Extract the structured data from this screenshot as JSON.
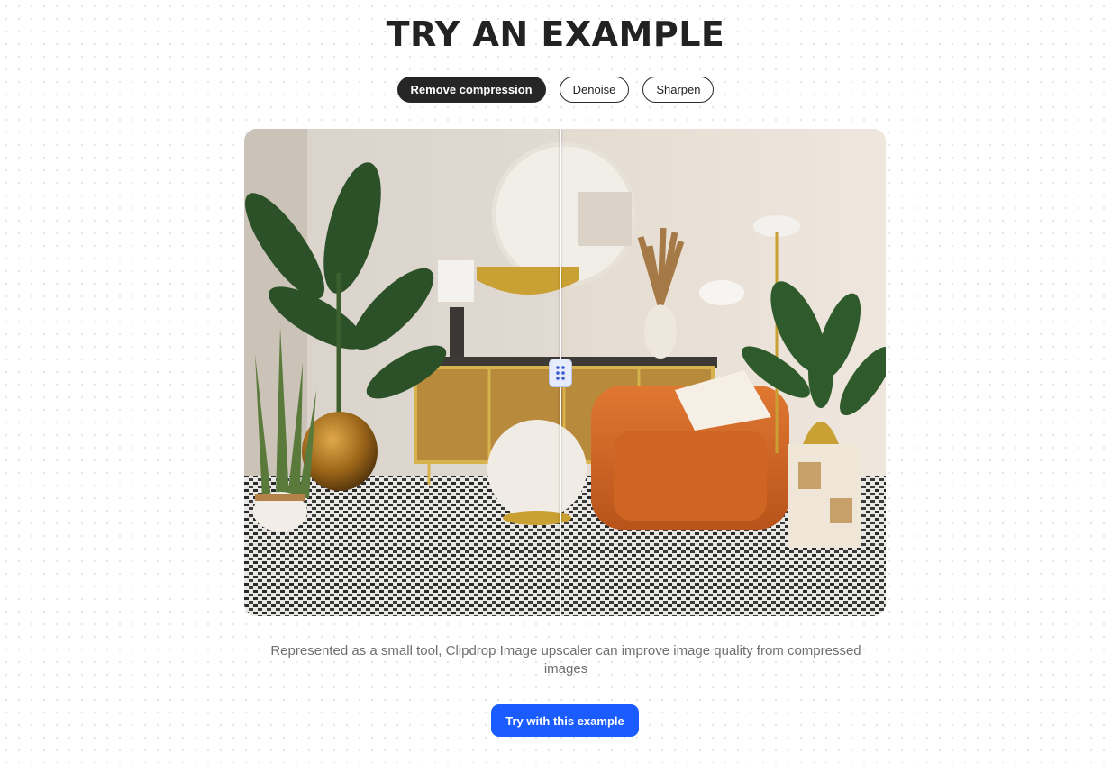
{
  "heading": "TRY AN EXAMPLE",
  "tabs": [
    {
      "label": "Remove compression",
      "active": true
    },
    {
      "label": "Denoise",
      "active": false
    },
    {
      "label": "Sharpen",
      "active": false
    }
  ],
  "comparison": {
    "image_description_icon": "interior-living-room-image",
    "slider_position_percent": 49,
    "handle_icon": "drag-dots-icon"
  },
  "caption": "Represented as a small tool, Clipdrop Image upscaler can improve image quality from compressed images",
  "cta_label": "Try with this example",
  "colors": {
    "accent": "#1a5cff",
    "active_tab": "#262626",
    "handle_bg": "#e6ecfb",
    "handle_dots": "#3a5ccc"
  }
}
